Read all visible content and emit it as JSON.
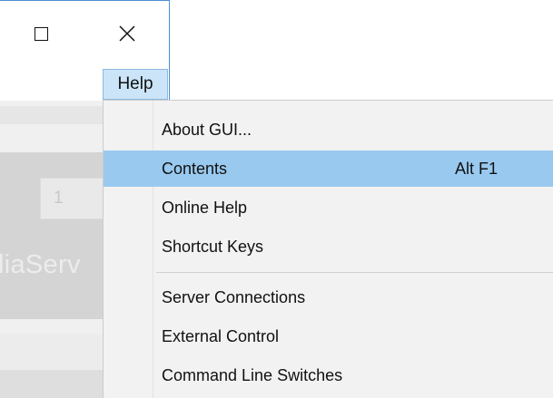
{
  "window": {
    "maximize_icon": "maximize-icon",
    "close_icon": "close-icon"
  },
  "menubar": {
    "help_label": "Help"
  },
  "background_app": {
    "field_value": "1",
    "label_fragment": "liaServ"
  },
  "menu": {
    "items": [
      {
        "label": "About GUI...",
        "shortcut": ""
      },
      {
        "label": "Contents",
        "shortcut": "Alt F1",
        "highlighted": true
      },
      {
        "label": "Online Help",
        "shortcut": ""
      },
      {
        "label": "Shortcut Keys",
        "shortcut": ""
      },
      {
        "label": "Server Connections",
        "shortcut": ""
      },
      {
        "label": "External Control",
        "shortcut": ""
      },
      {
        "label": "Command Line Switches",
        "shortcut": ""
      }
    ]
  },
  "colors": {
    "highlight": "#99c9ef",
    "menu_bg": "#f2f2f2",
    "help_active_bg": "#cce4f7"
  }
}
